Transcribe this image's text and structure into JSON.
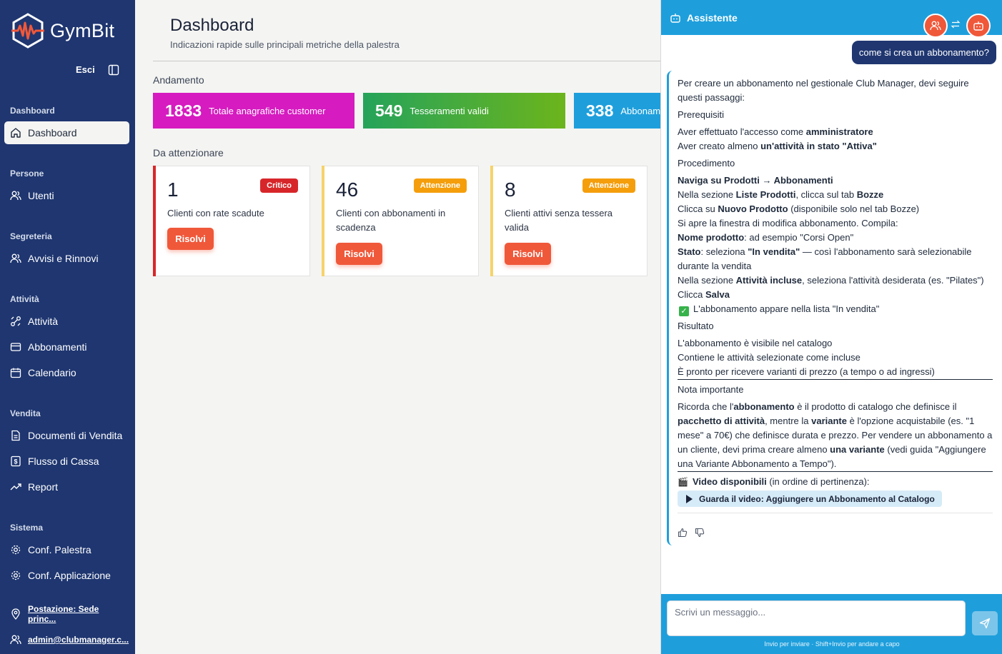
{
  "brand": {
    "name": "GymBit",
    "accent": "#f0583a",
    "sidebar_bg": "#1f3670"
  },
  "sidebar": {
    "logout": "Esci",
    "sections": [
      {
        "title": "Dashboard",
        "items": [
          {
            "label": "Dashboard",
            "icon": "home-icon",
            "active": true
          }
        ]
      },
      {
        "title": "Persone",
        "items": [
          {
            "label": "Utenti",
            "icon": "users-icon"
          }
        ]
      },
      {
        "title": "Segreteria",
        "items": [
          {
            "label": "Avvisi e Rinnovi",
            "icon": "users-icon"
          }
        ]
      },
      {
        "title": "Attività",
        "items": [
          {
            "label": "Attività",
            "icon": "activity-icon"
          },
          {
            "label": "Abbonamenti",
            "icon": "card-icon"
          },
          {
            "label": "Calendario",
            "icon": "calendar-icon"
          }
        ]
      },
      {
        "title": "Vendita",
        "items": [
          {
            "label": "Documenti di Vendita",
            "icon": "document-icon"
          },
          {
            "label": "Flusso di Cassa",
            "icon": "cash-icon"
          },
          {
            "label": "Report",
            "icon": "trend-icon"
          }
        ]
      },
      {
        "title": "Sistema",
        "items": [
          {
            "label": "Conf. Palestra",
            "icon": "gear-icon"
          },
          {
            "label": "Conf. Applicazione",
            "icon": "gear-icon"
          }
        ]
      }
    ],
    "footer": {
      "location": "Postazione: Sede princ...",
      "user": "admin@clubmanager.c..."
    }
  },
  "main": {
    "title": "Dashboard",
    "subtitle": "Indicazioni rapide sulle principali metriche della palestra",
    "trend_title": "Andamento",
    "metrics": [
      {
        "value": "1833",
        "label": "Totale anagrafiche customer",
        "color": "#d61bc0"
      },
      {
        "value": "549",
        "label": "Tesseramenti validi",
        "color": "#43a834"
      },
      {
        "value": "338",
        "label": "Abbonamenti",
        "color": "#1e9fdc"
      }
    ],
    "attention_title": "Da attenzionare",
    "cards": [
      {
        "count": "1",
        "badge": "Critico",
        "badge_color": "#d7262a",
        "bar_color": "#d7262a",
        "desc": "Clienti con rate scadute",
        "action": "Risolvi"
      },
      {
        "count": "46",
        "badge": "Attenzione",
        "badge_color": "#f59e0b",
        "bar_color": "#f6d36a",
        "desc": "Clienti con abbonamenti in scadenza",
        "action": "Risolvi"
      },
      {
        "count": "8",
        "badge": "Attenzione",
        "badge_color": "#f59e0b",
        "bar_color": "#f6d36a",
        "desc": "Clienti attivi senza tessera valida",
        "action": "Risolvi"
      }
    ]
  },
  "assistant": {
    "title": "Assistente",
    "user_message": "come si crea un abbonamento?",
    "answer": {
      "intro": "Per creare un abbonamento nel gestionale Club Manager, devi seguire questi passaggi:",
      "prereq_title": "Prerequisiti",
      "prereq_1_pre": "Aver effettuato l'accesso come ",
      "prereq_1_b": "amministratore",
      "prereq_2_pre": "Aver creato almeno ",
      "prereq_2_b": "un'attività in stato \"Attiva\"",
      "proc_title": "Procedimento",
      "step_nav": "Naviga su Prodotti → Abbonamenti",
      "step_1_a": "Nella sezione ",
      "step_1_b1": "Liste Prodotti",
      "step_1_c": ", clicca sul tab ",
      "step_1_b2": "Bozze",
      "step_2_a": "Clicca su ",
      "step_2_b": "Nuovo Prodotto",
      "step_2_c": " (disponibile solo nel tab Bozze)",
      "step_3": "Si apre la finestra di modifica abbonamento. Compila:",
      "step_4_b": "Nome prodotto",
      "step_4_c": ": ad esempio \"Corsi Open\"",
      "step_5_b": "Stato",
      "step_5_c": ": seleziona ",
      "step_5_b2": "\"In vendita\"",
      "step_5_d": " — così l'abbonamento sarà selezionabile durante la vendita",
      "step_6_a": "Nella sezione ",
      "step_6_b": "Attività incluse",
      "step_6_c": ", seleziona l'attività desiderata (es. \"Pilates\")",
      "step_7_a": "Clicca ",
      "step_7_b": "Salva",
      "step_8": "L'abbonamento appare nella lista \"In vendita\"",
      "result_title": "Risultato",
      "result_1": "L'abbonamento è visibile nel catalogo",
      "result_2": "Contiene le attività selezionate come incluse",
      "result_3": "È pronto per ricevere varianti di prezzo (a tempo o ad ingressi)",
      "note_title": "Nota importante",
      "note_a": "Ricorda che l'",
      "note_b1": "abbonamento",
      "note_c": " è il prodotto di catalogo che definisce il ",
      "note_b2": "pacchetto di attività",
      "note_d": ", mentre la ",
      "note_b3": "variante",
      "note_e": " è l'opzione acquistabile (es. \"1 mese\" a 70€) che definisce durata e prezzo. Per vendere un abbonamento a un cliente, devi prima creare almeno ",
      "note_b4": "una variante",
      "note_f": " (vedi guida \"Aggiungere una Variante Abbonamento a Tempo\").",
      "video_b": "Video disponibili",
      "video_c": " (in ordine di pertinenza):",
      "video_btn": "Guarda il video: Aggiungere un Abbonamento al Catalogo"
    },
    "input_placeholder": "Scrivi un messaggio...",
    "hint": "Invio per inviare · Shift+Invio per andare a capo"
  }
}
